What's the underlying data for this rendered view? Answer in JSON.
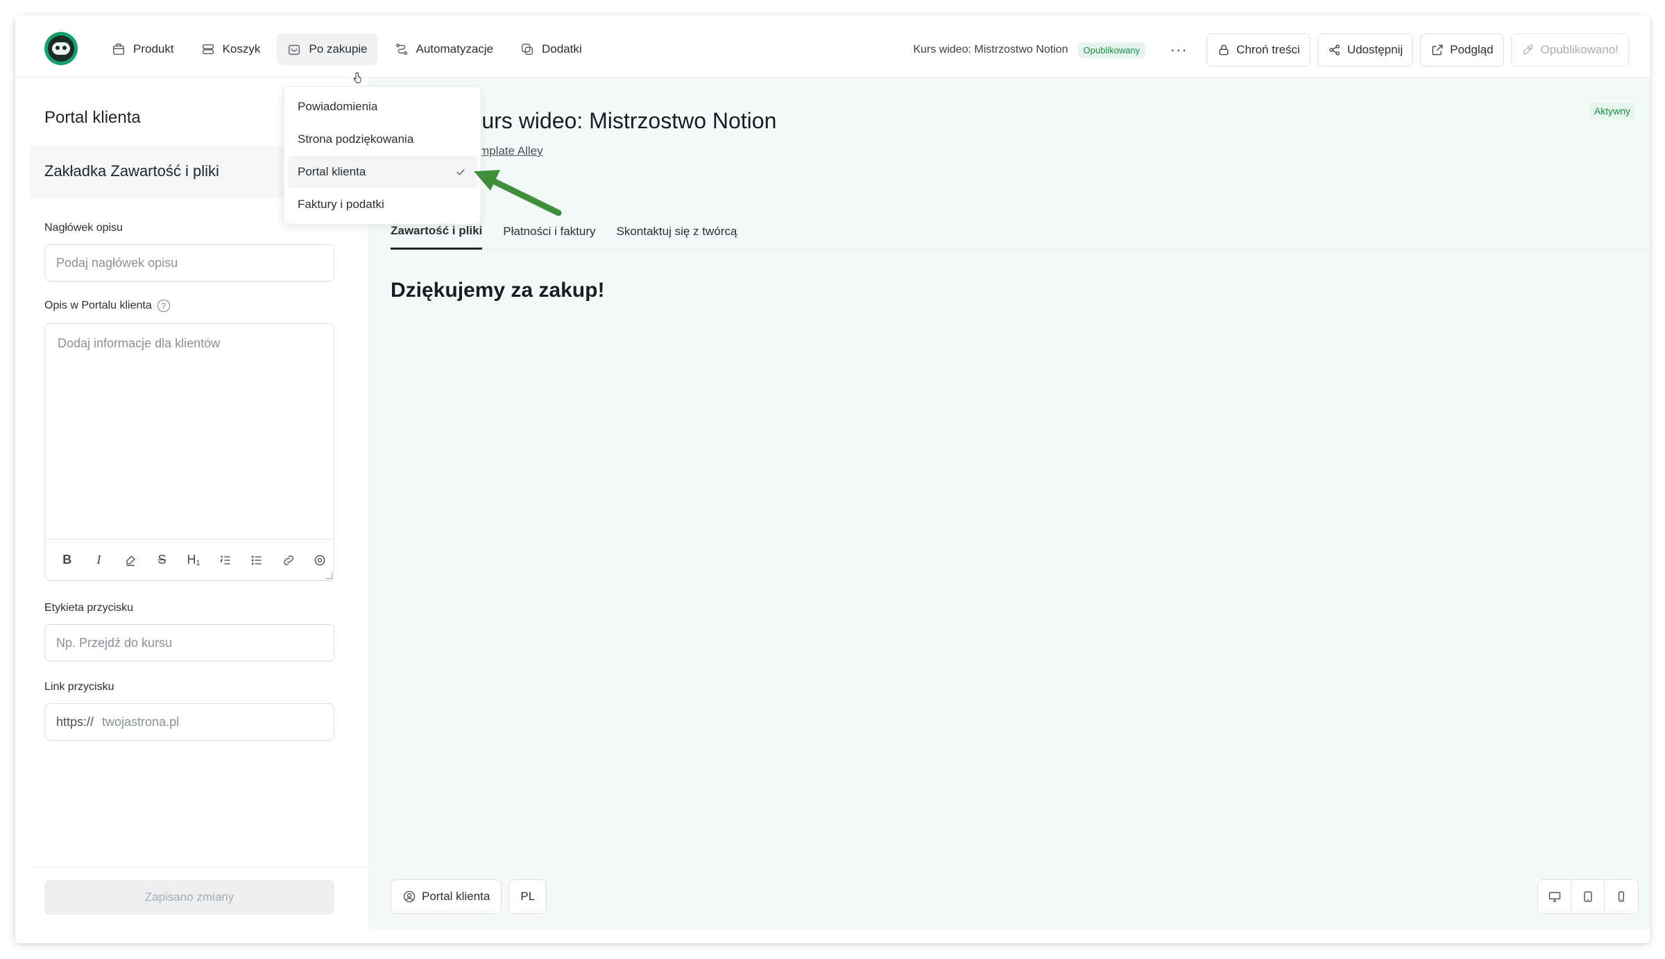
{
  "nav": {
    "items": [
      {
        "label": "Produkt",
        "icon": "box-icon"
      },
      {
        "label": "Koszyk",
        "icon": "cart-icon"
      },
      {
        "label": "Po zakupie",
        "icon": "bag-icon",
        "active": true
      },
      {
        "label": "Automatyzacje",
        "icon": "automation-icon"
      },
      {
        "label": "Dodatki",
        "icon": "addon-icon"
      }
    ]
  },
  "header": {
    "course_title": "Kurs wideo: Mistrzostwo Notion",
    "status_badge": "Opublikowany",
    "more": "···",
    "protect": "Chroń treści",
    "share": "Udostępnij",
    "preview": "Podgląd",
    "published": "Opublikowano!"
  },
  "dropdown": {
    "items": [
      {
        "label": "Powiadomienia"
      },
      {
        "label": "Strona podziękowania"
      },
      {
        "label": "Portal klienta",
        "selected": true
      },
      {
        "label": "Faktury i podatki"
      }
    ]
  },
  "left": {
    "title": "Portal klienta",
    "section": "Zakładka Zawartość i pliki",
    "desc_header_label": "Nagłówek opisu",
    "desc_header_placeholder": "Podaj nagłówek opisu",
    "portal_desc_label": "Opis w Portalu klienta",
    "portal_desc_placeholder": "Dodaj informacje dla klientów",
    "button_label_label": "Etykieta przycisku",
    "button_label_placeholder": "Np. Przejdź do kursu",
    "button_link_label": "Link przycisku",
    "button_link_prefix": "https://",
    "button_link_placeholder": "twojastrona.pl",
    "save": "Zapisano zmiany"
  },
  "preview": {
    "active_badge": "Aktywny",
    "title": "Kurs wideo: Mistrzostwo Notion",
    "creator": "Template Alley",
    "tabs": [
      {
        "label": "Zawartość i pliki",
        "active": true
      },
      {
        "label": "Płatności i faktury"
      },
      {
        "label": "Skontaktuj się z twórcą"
      }
    ],
    "thanks": "Dziękujemy za zakup!",
    "portal_button": "Portal klienta",
    "language": "PL"
  },
  "colors": {
    "brand": "#14a36b",
    "success_bg": "#e6f6ec",
    "success_text": "#1c8a4a",
    "preview_bg": "#f4fafa",
    "annotation_arrow": "#3f8f3a"
  }
}
